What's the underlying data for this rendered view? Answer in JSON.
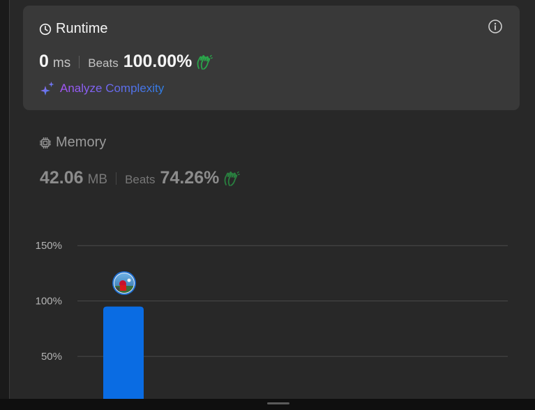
{
  "runtime": {
    "title": "Runtime",
    "value": "0",
    "unit": "ms",
    "beats_label": "Beats",
    "beats_value": "100.00%",
    "analyze_label": "Analyze Complexity"
  },
  "memory": {
    "title": "Memory",
    "value": "42.06",
    "unit": "MB",
    "beats_label": "Beats",
    "beats_value": "74.26%"
  },
  "chart_data": {
    "type": "bar",
    "y_ticks": [
      "150%",
      "100%",
      "50%"
    ],
    "y_tick_values": [
      150,
      100,
      50
    ],
    "ylim": [
      0,
      150
    ],
    "values": [
      95
    ],
    "bar_color": "#0a6ce3",
    "grid": true,
    "marker": "avatar"
  },
  "colors": {
    "accent_blue": "#0a6ce3",
    "beats_icon_green": "#2aa44a",
    "analyze_gradient_start": "#a855f7",
    "analyze_gradient_end": "#2f7fe6"
  }
}
